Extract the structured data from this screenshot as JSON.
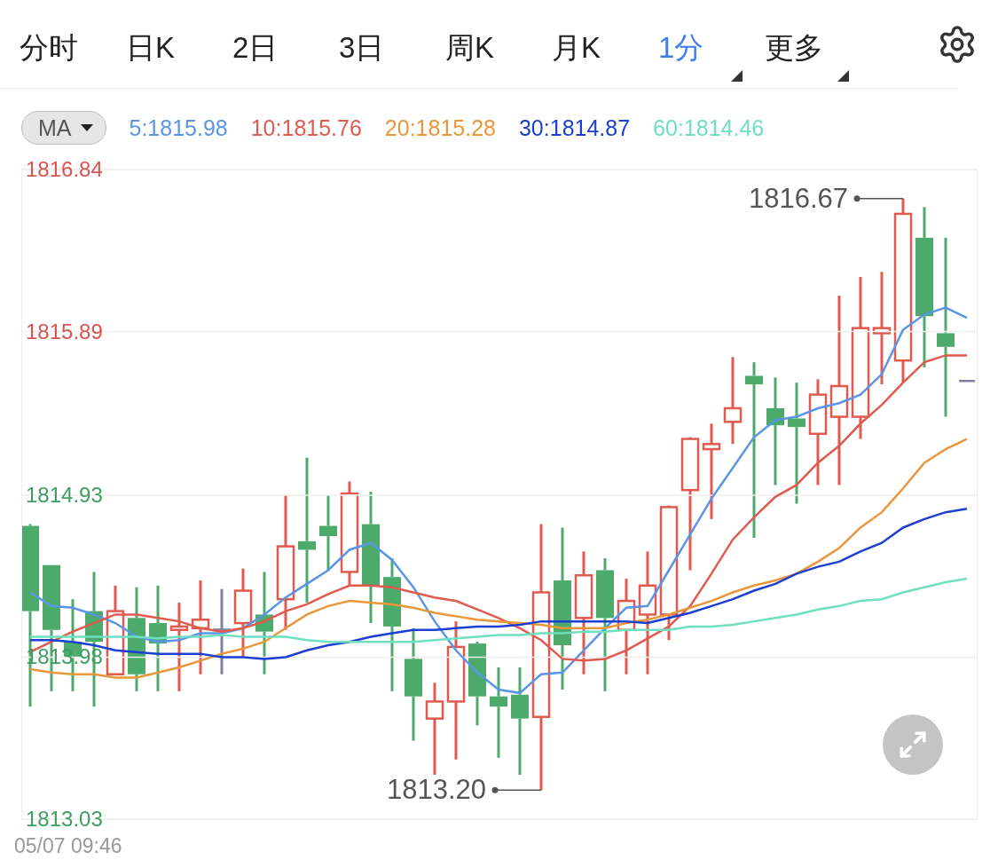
{
  "tabs": [
    {
      "label": "分时",
      "selected": false,
      "dropdown": false
    },
    {
      "label": "日K",
      "selected": false,
      "dropdown": false
    },
    {
      "label": "2日",
      "selected": false,
      "dropdown": false
    },
    {
      "label": "3日",
      "selected": false,
      "dropdown": false
    },
    {
      "label": "周K",
      "selected": false,
      "dropdown": false
    },
    {
      "label": "月K",
      "selected": false,
      "dropdown": false
    },
    {
      "label": "1分",
      "selected": true,
      "dropdown": true
    },
    {
      "label": "更多",
      "selected": false,
      "dropdown": true
    }
  ],
  "indicator_select": {
    "value": "MA"
  },
  "chart_data": {
    "type": "line",
    "grid": true,
    "ylim": [
      1813.03,
      1816.84
    ],
    "yticks": [
      {
        "value": 1816.84,
        "label": "1816.84"
      },
      {
        "value": 1815.89,
        "label": "1815.89"
      },
      {
        "value": 1814.93,
        "label": "1814.93"
      },
      {
        "value": 1813.98,
        "label": "1813.98"
      },
      {
        "value": 1813.03,
        "label": "1813.03"
      }
    ],
    "series": [
      {
        "name": "5:1815.98",
        "color": "#5b95e6",
        "values": [
          1814.36,
          1814.28,
          1814.27,
          1814.23,
          1814.18,
          1814.1,
          1814.07,
          1814.08,
          1814.12,
          1814.12,
          1814.15,
          1814.23,
          1814.33,
          1814.41,
          1814.49,
          1814.61,
          1814.65,
          1814.55,
          1814.39,
          1814.19,
          1814.02,
          1813.89,
          1813.79,
          1813.77,
          1813.88,
          1813.89,
          1814.02,
          1814.15,
          1814.27,
          1814.28,
          1814.49,
          1814.7,
          1814.91,
          1815.09,
          1815.27,
          1815.37,
          1815.39,
          1815.44,
          1815.47,
          1815.52,
          1815.64,
          1815.9,
          1815.99,
          1816.03,
          1815.97
        ]
      },
      {
        "name": "10:1815.76",
        "color": "#e05a4f",
        "values": [
          1814.01,
          1814.07,
          1814.13,
          1814.18,
          1814.23,
          1814.23,
          1814.21,
          1814.19,
          1814.15,
          1814.13,
          1814.15,
          1814.19,
          1814.25,
          1814.29,
          1814.35,
          1814.4,
          1814.4,
          1814.39,
          1814.36,
          1814.33,
          1814.31,
          1814.26,
          1814.21,
          1814.15,
          1814.08,
          1813.97,
          1813.96,
          1813.97,
          1814.02,
          1814.09,
          1814.16,
          1814.28,
          1814.47,
          1814.67,
          1814.8,
          1814.92,
          1814.99,
          1815.12,
          1815.22,
          1815.35,
          1815.46,
          1815.59,
          1815.71,
          1815.75,
          1815.75
        ]
      },
      {
        "name": "20:1815.28",
        "color": "#e9973a",
        "values": [
          1813.91,
          1813.89,
          1813.88,
          1813.88,
          1813.86,
          1813.86,
          1813.89,
          1813.92,
          1813.96,
          1814.0,
          1814.03,
          1814.07,
          1814.15,
          1814.23,
          1814.28,
          1814.31,
          1814.3,
          1814.29,
          1814.27,
          1814.24,
          1814.22,
          1814.2,
          1814.19,
          1814.18,
          1814.17,
          1814.15,
          1814.15,
          1814.15,
          1814.18,
          1814.2,
          1814.23,
          1814.27,
          1814.31,
          1814.36,
          1814.4,
          1814.43,
          1814.47,
          1814.54,
          1814.62,
          1814.74,
          1814.83,
          1814.97,
          1815.12,
          1815.2,
          1815.26
        ]
      },
      {
        "name": "30:1814.87",
        "color": "#1b3fd1",
        "values": [
          1814.08,
          1814.08,
          1814.07,
          1814.05,
          1814.02,
          1814.01,
          1814.0,
          1814.0,
          1814.0,
          1813.98,
          1813.98,
          1813.97,
          1813.98,
          1814.02,
          1814.05,
          1814.07,
          1814.1,
          1814.12,
          1814.14,
          1814.14,
          1814.15,
          1814.16,
          1814.16,
          1814.17,
          1814.19,
          1814.19,
          1814.19,
          1814.19,
          1814.19,
          1814.18,
          1814.21,
          1814.24,
          1814.28,
          1814.32,
          1814.37,
          1814.41,
          1814.47,
          1814.51,
          1814.54,
          1814.6,
          1814.65,
          1814.74,
          1814.79,
          1814.83,
          1814.85
        ]
      },
      {
        "name": "60:1814.46",
        "color": "#6ee0c0",
        "values": [
          1814.1,
          1814.1,
          1814.1,
          1814.1,
          1814.1,
          1814.1,
          1814.09,
          1814.1,
          1814.1,
          1814.11,
          1814.1,
          1814.1,
          1814.1,
          1814.08,
          1814.07,
          1814.07,
          1814.07,
          1814.07,
          1814.07,
          1814.08,
          1814.09,
          1814.1,
          1814.11,
          1814.11,
          1814.12,
          1814.12,
          1814.13,
          1814.13,
          1814.14,
          1814.14,
          1814.14,
          1814.16,
          1814.16,
          1814.17,
          1814.19,
          1814.21,
          1814.23,
          1814.26,
          1814.28,
          1814.31,
          1814.32,
          1814.36,
          1814.39,
          1814.42,
          1814.44
        ]
      }
    ],
    "annotations": [
      "1816.67",
      "1813.20"
    ]
  },
  "timestamp": "05/07 09:46"
}
